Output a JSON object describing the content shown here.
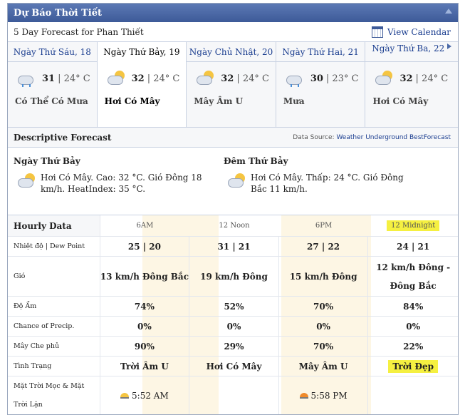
{
  "header": {
    "title": "Dự Báo Thời Tiết"
  },
  "subheader": {
    "location_text": "5 Day Forecast for Phan Thiết",
    "view_calendar": "View Calendar"
  },
  "days": [
    {
      "label": "Ngày Thứ Sáu, 18",
      "high": "31",
      "low": "| 24° C",
      "condition": "Có Thể Có Mưa",
      "icon": "rain-cloud-icon"
    },
    {
      "label": "Ngày Thứ Bảy, 19",
      "high": "32",
      "low": "| 24° C",
      "condition": "Hơi Có Mây",
      "icon": "partly-cloudy-icon"
    },
    {
      "label": "Ngày Chủ Nhật, 20",
      "high": "32",
      "low": "| 24° C",
      "condition": "Mây Âm U",
      "icon": "partly-cloudy-icon"
    },
    {
      "label": "Ngày Thứ Hai, 21",
      "high": "30",
      "low": "| 23° C",
      "condition": "Mưa",
      "icon": "rain-cloud-icon"
    },
    {
      "label": "Ngày Thứ Ba, 22",
      "high": "32",
      "low": "| 24° C",
      "condition": "Hơi Có Mây",
      "icon": "partly-cloudy-icon"
    }
  ],
  "descriptive": {
    "title": "Descriptive Forecast",
    "source_prefix": "Data Source:",
    "source_link": "Weather Underground BestForecast",
    "day": {
      "heading": "Ngày Thứ Bảy",
      "text": "Hơi Có Mây. Cao: 32 °C. Gió Đông 18 km/h. HeatIndex: 35 °C."
    },
    "night": {
      "heading": "Đêm Thứ Bảy",
      "text": "Hơi Có Mây. Thấp: 24 °C. Gió Đông Bắc 11 km/h."
    }
  },
  "hourly": {
    "title": "Hourly Data",
    "times": [
      "6AM",
      "12 Noon",
      "6PM",
      "12 Midnight"
    ],
    "rows": [
      {
        "label": "Nhiệt độ | Dew Point",
        "values": [
          "25 | 20",
          "31 | 21",
          "27 | 22",
          "24 | 21"
        ]
      },
      {
        "label": "Gió",
        "values": [
          "13 km/h Đông Bắc",
          "19 km/h Đông",
          "15 km/h Đông",
          "12 km/h Đông - Đông Bắc"
        ]
      },
      {
        "label": "Độ Ẩm",
        "values": [
          "74%",
          "52%",
          "70%",
          "84%"
        ]
      },
      {
        "label": "Chance of Precip.",
        "values": [
          "0%",
          "0%",
          "0%",
          "0%"
        ]
      },
      {
        "label": "Mây Che phủ",
        "values": [
          "90%",
          "29%",
          "70%",
          "22%"
        ]
      },
      {
        "label": "Tình Trạng",
        "values": [
          "Trời Âm U",
          "Hơi Có Mây",
          "Mây Âm U",
          "Trời Đẹp"
        ]
      }
    ],
    "sun_label": "Mặt Trời Mọc & Mặt Trời Lặn",
    "sunrise": "5:52 AM",
    "sunset": "5:58 PM"
  },
  "colors": {
    "title_bar": "#3d5a98",
    "link": "#1a3d8f",
    "highlight": "#f5f041",
    "shade": "#fdf6e4"
  }
}
